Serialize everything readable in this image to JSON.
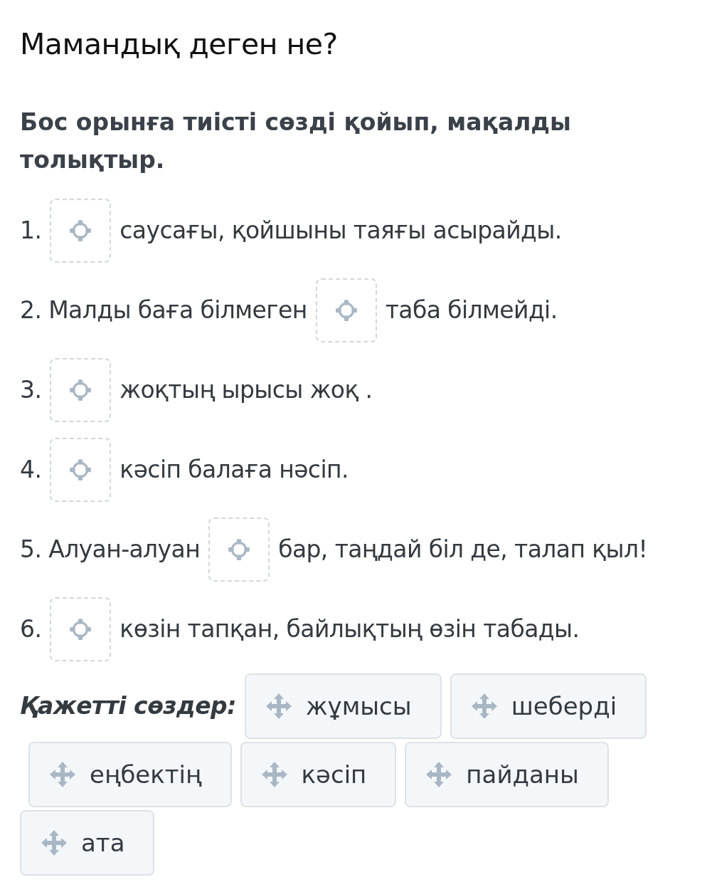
{
  "title": "Мамандық деген не?",
  "instruction": "Бос орынға тиісті сөзді қойып, мақалды толықтыр.",
  "sentences": [
    {
      "before": "1.",
      "after": "саусағы, қойшыны таяғы асырайды."
    },
    {
      "before": "2. Малды баға білмеген",
      "after": "таба білмейді."
    },
    {
      "before": "3.",
      "after": "жоқтың ырысы жоқ ."
    },
    {
      "before": "4.",
      "after": "кәсіп балаға нәсіп."
    },
    {
      "before": "5. Алуан-алуан",
      "after": "бар, таңдай біл де, талап қыл!"
    },
    {
      "before": "6.",
      "after": "көзін тапқан, байлықтың өзін табады."
    }
  ],
  "word_bank": {
    "label": "Қажетті сөздер:",
    "words": [
      "жұмысы",
      "шеберді",
      "еңбектің",
      "кәсіп",
      "пайданы",
      "ата"
    ]
  }
}
